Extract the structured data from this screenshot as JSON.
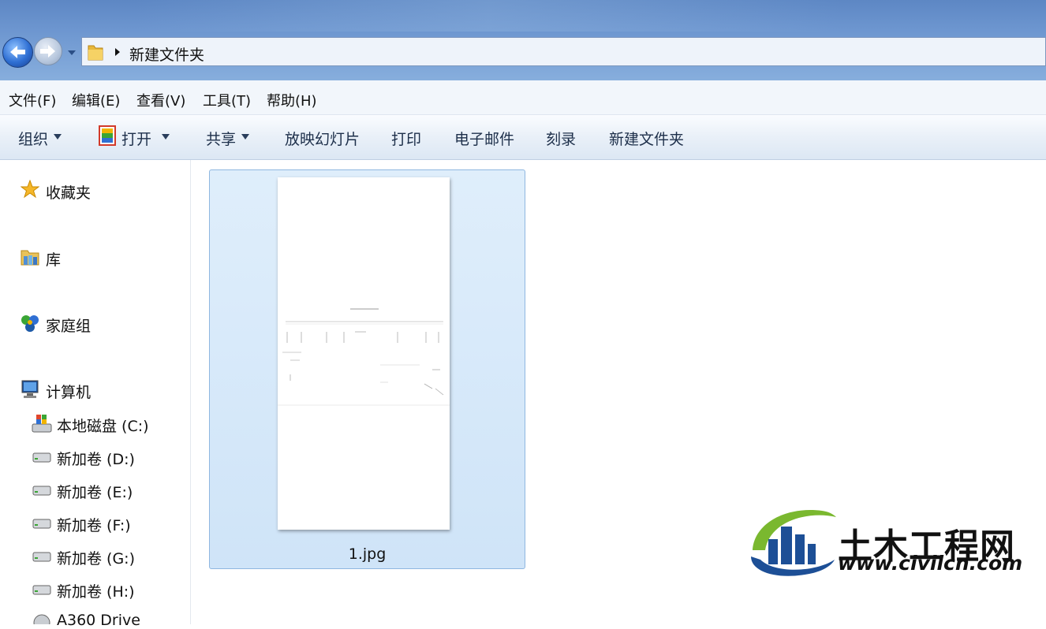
{
  "address": {
    "crumb": "新建文件夹"
  },
  "menu": [
    "文件(F)",
    "编辑(E)",
    "查看(V)",
    "工具(T)",
    "帮助(H)"
  ],
  "toolbar": {
    "organize": "组织",
    "open": "打开",
    "share": "共享",
    "slideshow": "放映幻灯片",
    "print": "打印",
    "email": "电子邮件",
    "burn": "刻录",
    "new_folder": "新建文件夹"
  },
  "nav": {
    "favorites": "收藏夹",
    "libraries": "库",
    "homegroup": "家庭组",
    "computer": "计算机",
    "drives": [
      "本地磁盘 (C:)",
      "新加卷 (D:)",
      "新加卷 (E:)",
      "新加卷 (F:)",
      "新加卷 (G:)",
      "新加卷 (H:)",
      "A360 Drive"
    ]
  },
  "file": {
    "name": "1.jpg"
  },
  "watermark": {
    "title": "土木工程网",
    "url": "www.civilcn.com"
  },
  "colors": {
    "selection": "#cfe4f8",
    "accent": "#2f6fd3",
    "logo_green": "#7ab82f"
  }
}
